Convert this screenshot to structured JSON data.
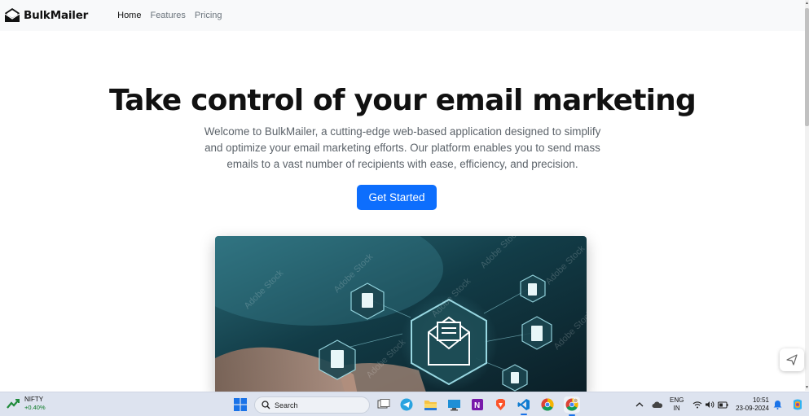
{
  "navbar": {
    "brand": "BulkMailer",
    "links": [
      {
        "label": "Home",
        "active": true
      },
      {
        "label": "Features",
        "active": false
      },
      {
        "label": "Pricing",
        "active": false
      }
    ]
  },
  "hero": {
    "title": "Take control of your email marketing",
    "description": "Welcome to BulkMailer, a cutting-edge web-based application designed to simplify and optimize your email marketing efforts. Our platform enables you to send mass emails to a vast number of recipients with ease, efficiency, and precision.",
    "cta_label": "Get Started",
    "image_watermark": "Adobe Stock"
  },
  "colors": {
    "accent": "#0d6efd",
    "navbar_bg": "#f8f9fa",
    "taskbar_bg": "#dde3ef"
  },
  "taskbar": {
    "ticker_name": "NIFTY",
    "ticker_change": "+0.40%",
    "search_placeholder": "Search",
    "apps": [
      "task-view-icon",
      "telegram-icon",
      "file-explorer-icon",
      "remote-desktop-icon",
      "onenote-icon",
      "brave-icon",
      "vscode-icon",
      "chrome-icon",
      "chrome-profile-icon"
    ],
    "lang_top": "ENG",
    "lang_bottom": "IN",
    "time": "10:51",
    "date": "23-09-2024"
  }
}
